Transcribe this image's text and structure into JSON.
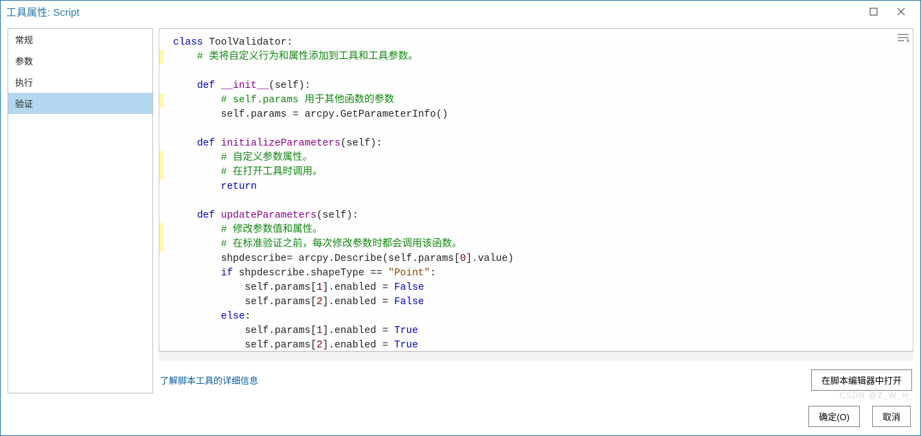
{
  "window": {
    "title": "工具属性: Script"
  },
  "sidebar": {
    "items": [
      {
        "label": "常规"
      },
      {
        "label": "参数"
      },
      {
        "label": "执行"
      },
      {
        "label": "验证"
      }
    ],
    "selected_index": 3
  },
  "editor": {
    "code_tokens": [
      [
        [
          "kw",
          "class"
        ],
        [
          "sp",
          " "
        ],
        [
          "id",
          "ToolValidator"
        ],
        [
          "id",
          ":"
        ]
      ],
      [
        [
          "in",
          1
        ],
        [
          "cm",
          "# 类将自定义行为和属性添加到工具和工具参数。"
        ]
      ],
      [],
      [
        [
          "in",
          1
        ],
        [
          "kw",
          "def"
        ],
        [
          "sp",
          " "
        ],
        [
          "fn",
          "__init__"
        ],
        [
          "id",
          "(self):"
        ]
      ],
      [
        [
          "in",
          2
        ],
        [
          "cm",
          "# self.params 用于其他函数的参数"
        ]
      ],
      [
        [
          "in",
          2
        ],
        [
          "id",
          "self.params = arcpy.GetParameterInfo()"
        ]
      ],
      [],
      [
        [
          "in",
          1
        ],
        [
          "kw",
          "def"
        ],
        [
          "sp",
          " "
        ],
        [
          "fn",
          "initializeParameters"
        ],
        [
          "id",
          "(self):"
        ]
      ],
      [
        [
          "in",
          2
        ],
        [
          "cm",
          "# 自定义参数属性。"
        ]
      ],
      [
        [
          "in",
          2
        ],
        [
          "cm",
          "# 在打开工具时调用。"
        ]
      ],
      [
        [
          "in",
          2
        ],
        [
          "kw",
          "return"
        ]
      ],
      [],
      [
        [
          "in",
          1
        ],
        [
          "kw",
          "def"
        ],
        [
          "sp",
          " "
        ],
        [
          "fn",
          "updateParameters"
        ],
        [
          "id",
          "(self):"
        ]
      ],
      [
        [
          "in",
          2
        ],
        [
          "cm",
          "# 修改参数值和属性。"
        ]
      ],
      [
        [
          "in",
          2
        ],
        [
          "cm",
          "# 在标准验证之前，每次修改参数时都会调用该函数。"
        ]
      ],
      [
        [
          "in",
          2
        ],
        [
          "id",
          "shpdescribe= arcpy.Describe(self.params["
        ],
        [
          "num",
          "0"
        ],
        [
          "id",
          "].value)"
        ]
      ],
      [
        [
          "in",
          2
        ],
        [
          "kw",
          "if"
        ],
        [
          "sp",
          " "
        ],
        [
          "id",
          "shpdescribe.shapeType == "
        ],
        [
          "str",
          "\"Point\""
        ],
        [
          "id",
          ":"
        ]
      ],
      [
        [
          "in",
          3
        ],
        [
          "id",
          "self.params["
        ],
        [
          "num",
          "1"
        ],
        [
          "id",
          "].enabled = "
        ],
        [
          "kw",
          "False"
        ]
      ],
      [
        [
          "in",
          3
        ],
        [
          "id",
          "self.params["
        ],
        [
          "num",
          "2"
        ],
        [
          "id",
          "].enabled = "
        ],
        [
          "kw",
          "False"
        ]
      ],
      [
        [
          "in",
          2
        ],
        [
          "kw",
          "else"
        ],
        [
          "id",
          ":"
        ]
      ],
      [
        [
          "in",
          3
        ],
        [
          "id",
          "self.params["
        ],
        [
          "num",
          "1"
        ],
        [
          "id",
          "].enabled = "
        ],
        [
          "kw",
          "True"
        ]
      ],
      [
        [
          "in",
          3
        ],
        [
          "id",
          "self.params["
        ],
        [
          "num",
          "2"
        ],
        [
          "id",
          "].enabled = "
        ],
        [
          "kw",
          "True"
        ]
      ]
    ],
    "highlight_lines": [
      1,
      4,
      8,
      9,
      13,
      14
    ]
  },
  "actions": {
    "learn_more": "了解脚本工具的详细信息",
    "open_in_editor": "在脚本编辑器中打开",
    "ok": "确定(O)",
    "cancel": "取消"
  },
  "watermark": "CSDN @Z_W_H_"
}
